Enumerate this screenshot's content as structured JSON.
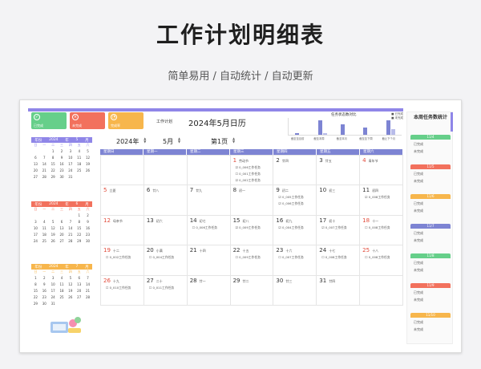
{
  "hero": {
    "title": "工作计划明细表",
    "subtitle": "简单易用  /  自动统计  /  自动更新"
  },
  "cards": [
    {
      "label": "已完成",
      "icon": "check-circle-icon",
      "color": "#66cf8a"
    },
    {
      "label": "未完成",
      "icon": "cross-circle-icon",
      "color": "#f2715d"
    },
    {
      "label": "完成率",
      "icon": "pie-icon",
      "color": "#f7b64c"
    }
  ],
  "mini_calendars": [
    {
      "year_label": "年份",
      "year": "2024",
      "month_label": "年",
      "month": "5",
      "month_unit": "月",
      "color": "#8f86e8",
      "days": [
        "",
        "",
        "1",
        "2",
        "3",
        "4",
        "5",
        "6",
        "7",
        "8",
        "9",
        "10",
        "11",
        "12",
        "13",
        "14",
        "15",
        "16",
        "17",
        "18",
        "19",
        "20",
        "21",
        "22",
        "23",
        "24",
        "25",
        "26",
        "27",
        "28",
        "29",
        "30",
        "31"
      ]
    },
    {
      "year_label": "年份",
      "year": "2024",
      "month_label": "年",
      "month": "6",
      "month_unit": "月",
      "color": "#f2715d",
      "days": [
        "",
        "",
        "",
        "",
        "",
        "1",
        "2",
        "3",
        "4",
        "5",
        "6",
        "7",
        "8",
        "9",
        "10",
        "11",
        "12",
        "13",
        "14",
        "15",
        "16",
        "17",
        "18",
        "19",
        "20",
        "21",
        "22",
        "23",
        "24",
        "25",
        "26",
        "27",
        "28",
        "29",
        "30"
      ]
    },
    {
      "year_label": "年份",
      "year": "2024",
      "month_label": "年",
      "month": "7",
      "month_unit": "月",
      "color": "#f7b64c",
      "days": [
        "1",
        "2",
        "3",
        "4",
        "5",
        "6",
        "7",
        "8",
        "9",
        "10",
        "11",
        "12",
        "13",
        "14",
        "15",
        "16",
        "17",
        "18",
        "19",
        "20",
        "21",
        "22",
        "23",
        "24",
        "25",
        "26",
        "27",
        "28",
        "29",
        "30",
        "31"
      ]
    }
  ],
  "mini_weekdays": [
    "日",
    "一",
    "二",
    "三",
    "四",
    "五",
    "六"
  ],
  "calendar": {
    "plan_label": "工作计划",
    "title": "2024年5月日历",
    "year_select": "2024年",
    "month_select": "5月",
    "page_select": "第1页",
    "weekdays": [
      "星期日",
      "星期一",
      "星期二",
      "星期三",
      "星期四",
      "星期五",
      "星期六"
    ],
    "cells": [
      {
        "d": "",
        "h": "",
        "tasks": []
      },
      {
        "d": "",
        "h": "",
        "tasks": []
      },
      {
        "d": "",
        "h": "",
        "tasks": []
      },
      {
        "d": "1",
        "h": "劳动节",
        "red": true,
        "tasks": [
          "☑  0_006工作任务",
          "☐  0_001工作任务",
          "☑  0_002工作任务"
        ]
      },
      {
        "d": "2",
        "h": "廿四",
        "tasks": []
      },
      {
        "d": "3",
        "h": "廿五",
        "tasks": []
      },
      {
        "d": "4",
        "h": "青年节",
        "red": true,
        "tasks": []
      },
      {
        "d": "5",
        "h": "立夏",
        "red": true,
        "tasks": []
      },
      {
        "d": "6",
        "h": "廿八",
        "tasks": []
      },
      {
        "d": "7",
        "h": "廿九",
        "tasks": []
      },
      {
        "d": "8",
        "h": "初一",
        "tasks": []
      },
      {
        "d": "9",
        "h": "初二",
        "tasks": [
          "☑  0_005工作任务",
          "☑  0_006工作任务"
        ]
      },
      {
        "d": "10",
        "h": "初三",
        "tasks": []
      },
      {
        "d": "11",
        "h": "初四",
        "tasks": [
          "☑  0_008工作任务"
        ]
      },
      {
        "d": "12",
        "h": "母亲节",
        "red": true,
        "tasks": []
      },
      {
        "d": "13",
        "h": "初六",
        "tasks": []
      },
      {
        "d": "14",
        "h": "初七",
        "tasks": [
          "☐  0_006工作任务"
        ]
      },
      {
        "d": "15",
        "h": "初八",
        "tasks": [
          "☑  0_009工作任务"
        ]
      },
      {
        "d": "16",
        "h": "初九",
        "tasks": [
          "☑  0_004工作任务"
        ]
      },
      {
        "d": "17",
        "h": "初十",
        "tasks": [
          "☑  0_007工作任务"
        ]
      },
      {
        "d": "18",
        "h": "十一",
        "red": true,
        "tasks": [
          "☐  0_008工作任务"
        ]
      },
      {
        "d": "19",
        "h": "十二",
        "red": true,
        "tasks": [
          "☐  0_002工作任务"
        ]
      },
      {
        "d": "20",
        "h": "小满",
        "tasks": [
          "☐  0_004工作任务"
        ]
      },
      {
        "d": "21",
        "h": "十四",
        "tasks": []
      },
      {
        "d": "22",
        "h": "十五",
        "tasks": [
          "☐  0_009工作任务"
        ]
      },
      {
        "d": "23",
        "h": "十六",
        "tasks": [
          "☐  0_007工作任务"
        ]
      },
      {
        "d": "24",
        "h": "十七",
        "tasks": [
          "☐  0_008工作任务"
        ]
      },
      {
        "d": "25",
        "h": "十八",
        "red": true,
        "tasks": [
          "☐  0_008工作任务"
        ]
      },
      {
        "d": "26",
        "h": "十九",
        "red": true,
        "tasks": [
          "☐  0_010工作任务"
        ]
      },
      {
        "d": "27",
        "h": "二十",
        "tasks": [
          "☐  0_011工作任务"
        ]
      },
      {
        "d": "28",
        "h": "廿一",
        "tasks": []
      },
      {
        "d": "29",
        "h": "廿二",
        "tasks": []
      },
      {
        "d": "30",
        "h": "廿三",
        "tasks": []
      },
      {
        "d": "31",
        "h": "廿四",
        "tasks": []
      },
      {
        "d": "",
        "h": "",
        "tasks": []
      }
    ]
  },
  "chart_data": {
    "type": "bar",
    "title": "任务状态数对比",
    "categories": [
      "截至至目前",
      "截至本周",
      "截至本月",
      "截至至下周",
      "截止下个月"
    ],
    "series": [
      {
        "name": "已完成",
        "values": [
          1,
          8,
          6,
          4,
          8
        ],
        "color": "#7d84d3"
      },
      {
        "name": "未完成",
        "values": [
          0,
          1,
          0,
          0,
          3
        ],
        "color": "#b8bcea"
      }
    ],
    "ylim": [
      0,
      10
    ]
  },
  "weekly": {
    "title": "本周任务数统计",
    "done_label": "已完成",
    "todo_label": "未完成",
    "days": [
      {
        "date": "11/4",
        "color": "#66cf8a"
      },
      {
        "date": "11/5",
        "color": "#f2715d"
      },
      {
        "date": "11/6",
        "color": "#f7b64c"
      },
      {
        "date": "11/7",
        "color": "#7d84d3"
      },
      {
        "date": "11/8",
        "color": "#66cf8a"
      },
      {
        "date": "11/9",
        "color": "#f2715d"
      },
      {
        "date": "11/10",
        "color": "#f7b64c"
      }
    ]
  }
}
